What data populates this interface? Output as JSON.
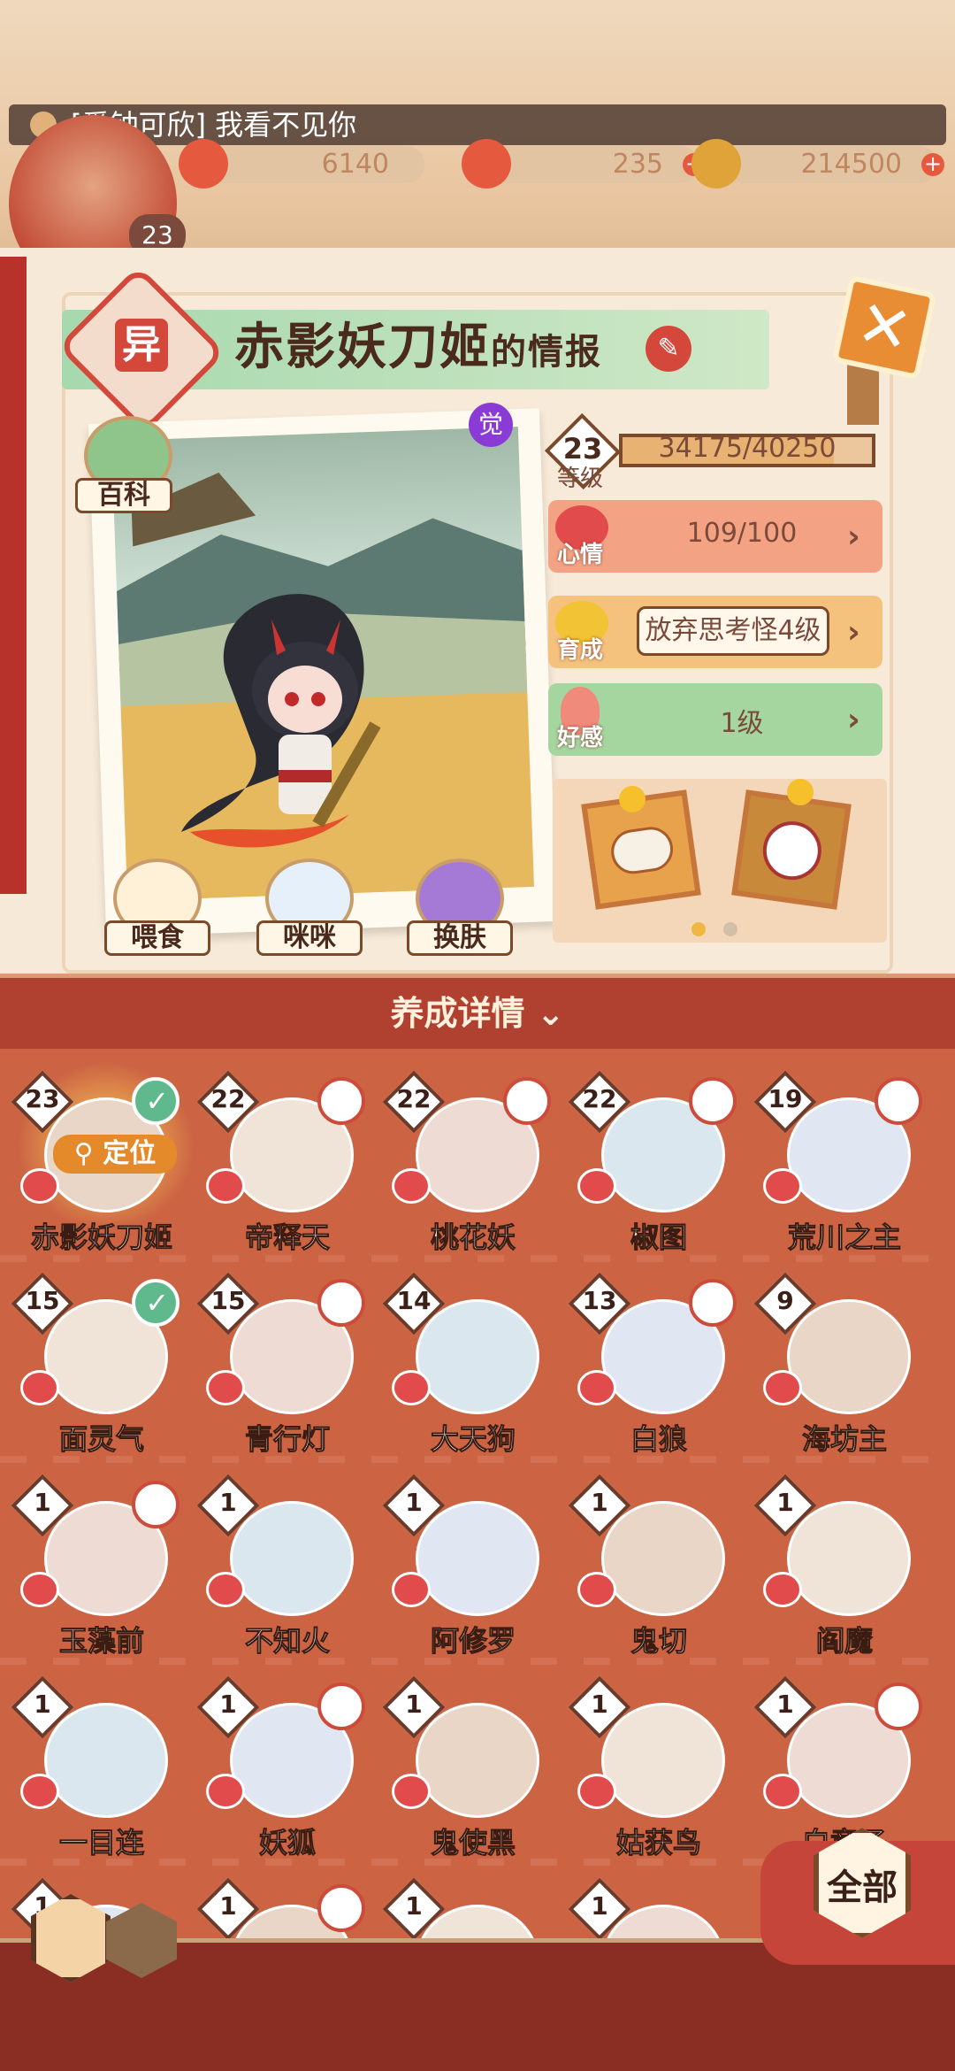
{
  "announcement": "[爱钟可欣] 我看不见你",
  "player": {
    "level": "23"
  },
  "resources": [
    {
      "name": "red-crystal",
      "value": "6140",
      "color": "#e55a3f"
    },
    {
      "name": "spirit-orb",
      "value": "235",
      "color": "#e55a3f"
    },
    {
      "name": "gold-coin",
      "value": "214500",
      "color": "#e0a33a"
    }
  ],
  "header": {
    "badge": "异",
    "title": "赤影妖刀姬",
    "title_suffix": "的情报",
    "close_icon": "close-x-icon"
  },
  "portrait": {
    "awaken_badge": "觉",
    "wiki_label": "百科",
    "actions": [
      "喂食",
      "咪咪",
      "换肤"
    ]
  },
  "stats": {
    "level": "23",
    "level_label": "等级",
    "exp": "34175/40250",
    "exp_fraction": 0.849,
    "mood_label": "心情",
    "mood_value": "109/100",
    "grow_label": "育成",
    "grow_value": "放弃思考怪4级",
    "fav_label": "好感",
    "fav_value": "1级"
  },
  "details_label": "养成详情",
  "characters": [
    {
      "name": "赤影妖刀姬",
      "level": "23",
      "tag": "check",
      "locate": "定位"
    },
    {
      "name": "帝释天",
      "level": "22",
      "tag": "ring"
    },
    {
      "name": "桃花妖",
      "level": "22",
      "tag": "ring"
    },
    {
      "name": "椒图",
      "level": "22",
      "tag": "ring"
    },
    {
      "name": "荒川之主",
      "level": "19",
      "tag": "ring"
    },
    {
      "name": "面灵气",
      "level": "15",
      "tag": "check"
    },
    {
      "name": "青行灯",
      "level": "15",
      "tag": "ring"
    },
    {
      "name": "大天狗",
      "level": "14",
      "tag": "none"
    },
    {
      "name": "白狼",
      "level": "13",
      "tag": "ring"
    },
    {
      "name": "海坊主",
      "level": "9",
      "tag": "none"
    },
    {
      "name": "玉藻前",
      "level": "1",
      "tag": "ring"
    },
    {
      "name": "不知火",
      "level": "1",
      "tag": "none"
    },
    {
      "name": "阿修罗",
      "level": "1",
      "tag": "none"
    },
    {
      "name": "鬼切",
      "level": "1",
      "tag": "none"
    },
    {
      "name": "阎魔",
      "level": "1",
      "tag": "none"
    },
    {
      "name": "一目连",
      "level": "1",
      "tag": "none"
    },
    {
      "name": "妖狐",
      "level": "1",
      "tag": "ring"
    },
    {
      "name": "鬼使黑",
      "level": "1",
      "tag": "none"
    },
    {
      "name": "姑获鸟",
      "level": "1",
      "tag": "none"
    },
    {
      "name": "白童子",
      "level": "1",
      "tag": "ring"
    },
    {
      "name": "",
      "level": "1",
      "tag": "none"
    },
    {
      "name": "",
      "level": "1",
      "tag": "ring"
    },
    {
      "name": "",
      "level": "1",
      "tag": "none"
    },
    {
      "name": "",
      "level": "1",
      "tag": "none"
    }
  ],
  "filter_label": "全部"
}
